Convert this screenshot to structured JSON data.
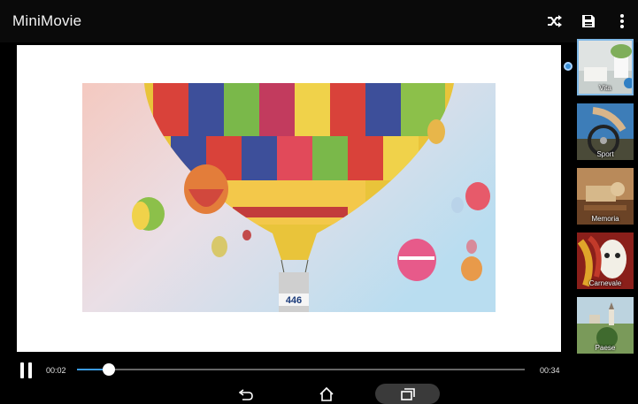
{
  "app": {
    "title": "MiniMovie"
  },
  "toolbar": {
    "icons": [
      "shuffle-icon",
      "save-icon",
      "more-vert-icon"
    ]
  },
  "themes": [
    {
      "label": "Vita",
      "selected": true
    },
    {
      "label": "Sport",
      "selected": false
    },
    {
      "label": "Memoria",
      "selected": false
    },
    {
      "label": "Carnevale",
      "selected": false
    },
    {
      "label": "Paese",
      "selected": false
    }
  ],
  "player": {
    "state": "playing",
    "current_time": "00:02",
    "total_time": "00:34",
    "progress": 0.072
  },
  "photo": {
    "basket_number": "446"
  },
  "navbar": {
    "icons": [
      "back-icon",
      "home-icon",
      "recents-icon"
    ]
  },
  "colors": {
    "accent": "#3a9be0",
    "appbar": "#0a0a0a",
    "preview_bg": "#ffffff"
  }
}
